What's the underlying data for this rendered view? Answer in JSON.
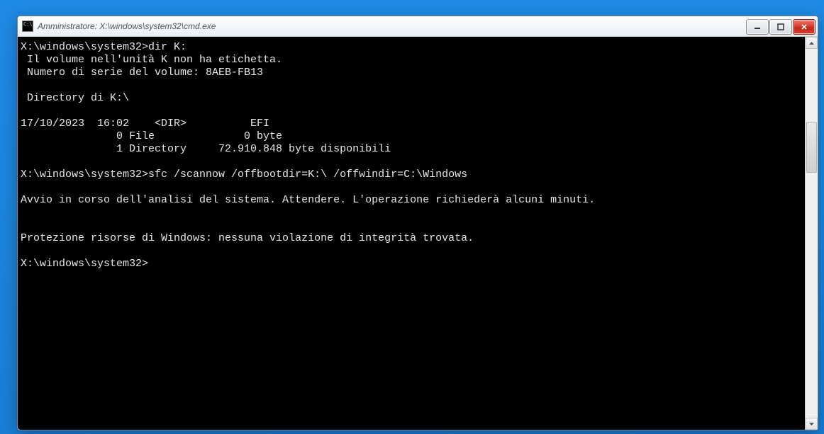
{
  "window": {
    "title": "Amministratore: X:\\windows\\system32\\cmd.exe"
  },
  "console": {
    "lines": [
      "X:\\windows\\system32>dir K:",
      " Il volume nell'unità K non ha etichetta.",
      " Numero di serie del volume: 8AEB-FB13",
      "",
      " Directory di K:\\",
      "",
      "17/10/2023  16:02    <DIR>          EFI",
      "               0 File              0 byte",
      "               1 Directory     72.910.848 byte disponibili",
      "",
      "X:\\windows\\system32>sfc /scannow /offbootdir=K:\\ /offwindir=C:\\Windows",
      "",
      "Avvio in corso dell'analisi del sistema. Attendere. L'operazione richiederà alcuni minuti.",
      "",
      "",
      "Protezione risorse di Windows: nessuna violazione di integrità trovata.",
      "",
      "X:\\windows\\system32>"
    ]
  }
}
